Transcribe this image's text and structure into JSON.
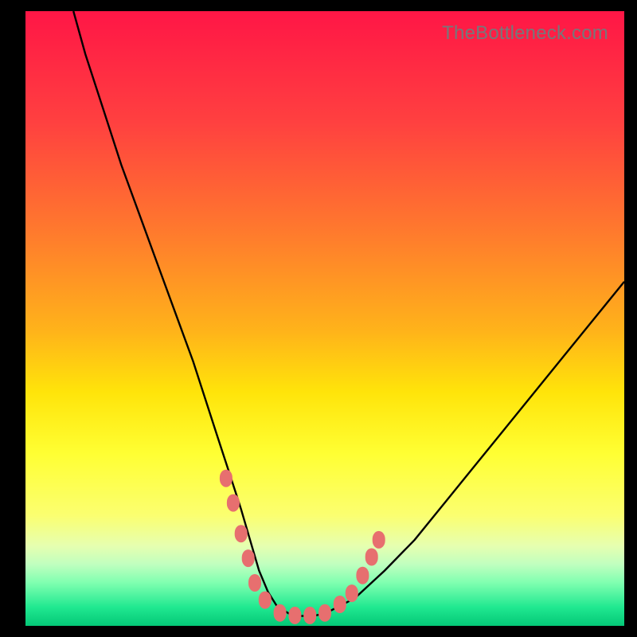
{
  "watermark": {
    "text": "TheBottleneck.com"
  },
  "chart_data": {
    "type": "line",
    "title": "",
    "xlabel": "",
    "ylabel": "",
    "xlim": [
      0,
      100
    ],
    "ylim": [
      0,
      100
    ],
    "series": [
      {
        "name": "bottleneck-curve",
        "x": [
          8,
          10,
          13,
          16,
          19,
          22,
          25,
          28,
          30,
          32,
          34,
          36,
          37.5,
          39,
          40.5,
          42,
          44,
          46,
          48,
          50,
          55,
          60,
          65,
          70,
          75,
          80,
          85,
          90,
          95,
          100
        ],
        "y": [
          100,
          93,
          84,
          75,
          67,
          59,
          51,
          43,
          37,
          31,
          25,
          19,
          14,
          9,
          5.5,
          3.2,
          2.0,
          1.6,
          1.6,
          2.0,
          4.5,
          9,
          14,
          20,
          26,
          32,
          38,
          44,
          50,
          56
        ]
      }
    ],
    "markers": [
      {
        "name": "trough-markers",
        "color": "#e76f6f",
        "points": [
          {
            "x": 33.5,
            "y": 24
          },
          {
            "x": 34.7,
            "y": 20
          },
          {
            "x": 36.0,
            "y": 15
          },
          {
            "x": 37.2,
            "y": 11
          },
          {
            "x": 38.3,
            "y": 7
          },
          {
            "x": 40.0,
            "y": 4.2
          },
          {
            "x": 42.5,
            "y": 2.1
          },
          {
            "x": 45.0,
            "y": 1.7
          },
          {
            "x": 47.5,
            "y": 1.7
          },
          {
            "x": 50.0,
            "y": 2.1
          },
          {
            "x": 52.5,
            "y": 3.5
          },
          {
            "x": 54.5,
            "y": 5.3
          },
          {
            "x": 56.3,
            "y": 8.2
          },
          {
            "x": 57.8,
            "y": 11.2
          },
          {
            "x": 59.0,
            "y": 14.0
          }
        ]
      }
    ]
  }
}
